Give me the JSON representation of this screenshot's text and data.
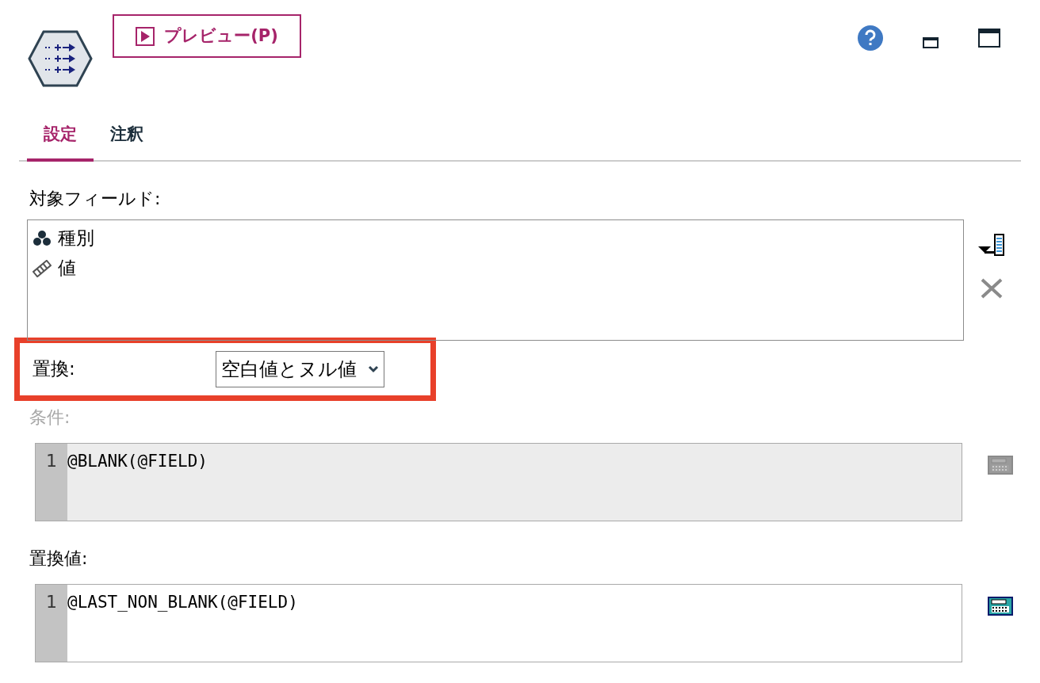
{
  "toolbar": {
    "preview_button": "プレビュー(P)"
  },
  "tabs": [
    {
      "label": "設定",
      "selected": true
    },
    {
      "label": "注釈",
      "selected": false
    }
  ],
  "target_fields": {
    "label": "対象フィールド:",
    "items": [
      {
        "kind": "set",
        "name": "種別"
      },
      {
        "kind": "continuous",
        "name": "値"
      }
    ]
  },
  "replace": {
    "label": "置換:",
    "value": "空白値とヌル値",
    "highlighted": true
  },
  "condition": {
    "label": "条件:",
    "disabled": true,
    "lines": [
      {
        "number": "1",
        "code": "@BLANK(@FIELD)"
      }
    ]
  },
  "replace_value": {
    "label": "置換値:",
    "disabled": false,
    "lines": [
      {
        "number": "1",
        "code": "@LAST_NON_BLANK(@FIELD)"
      }
    ]
  }
}
